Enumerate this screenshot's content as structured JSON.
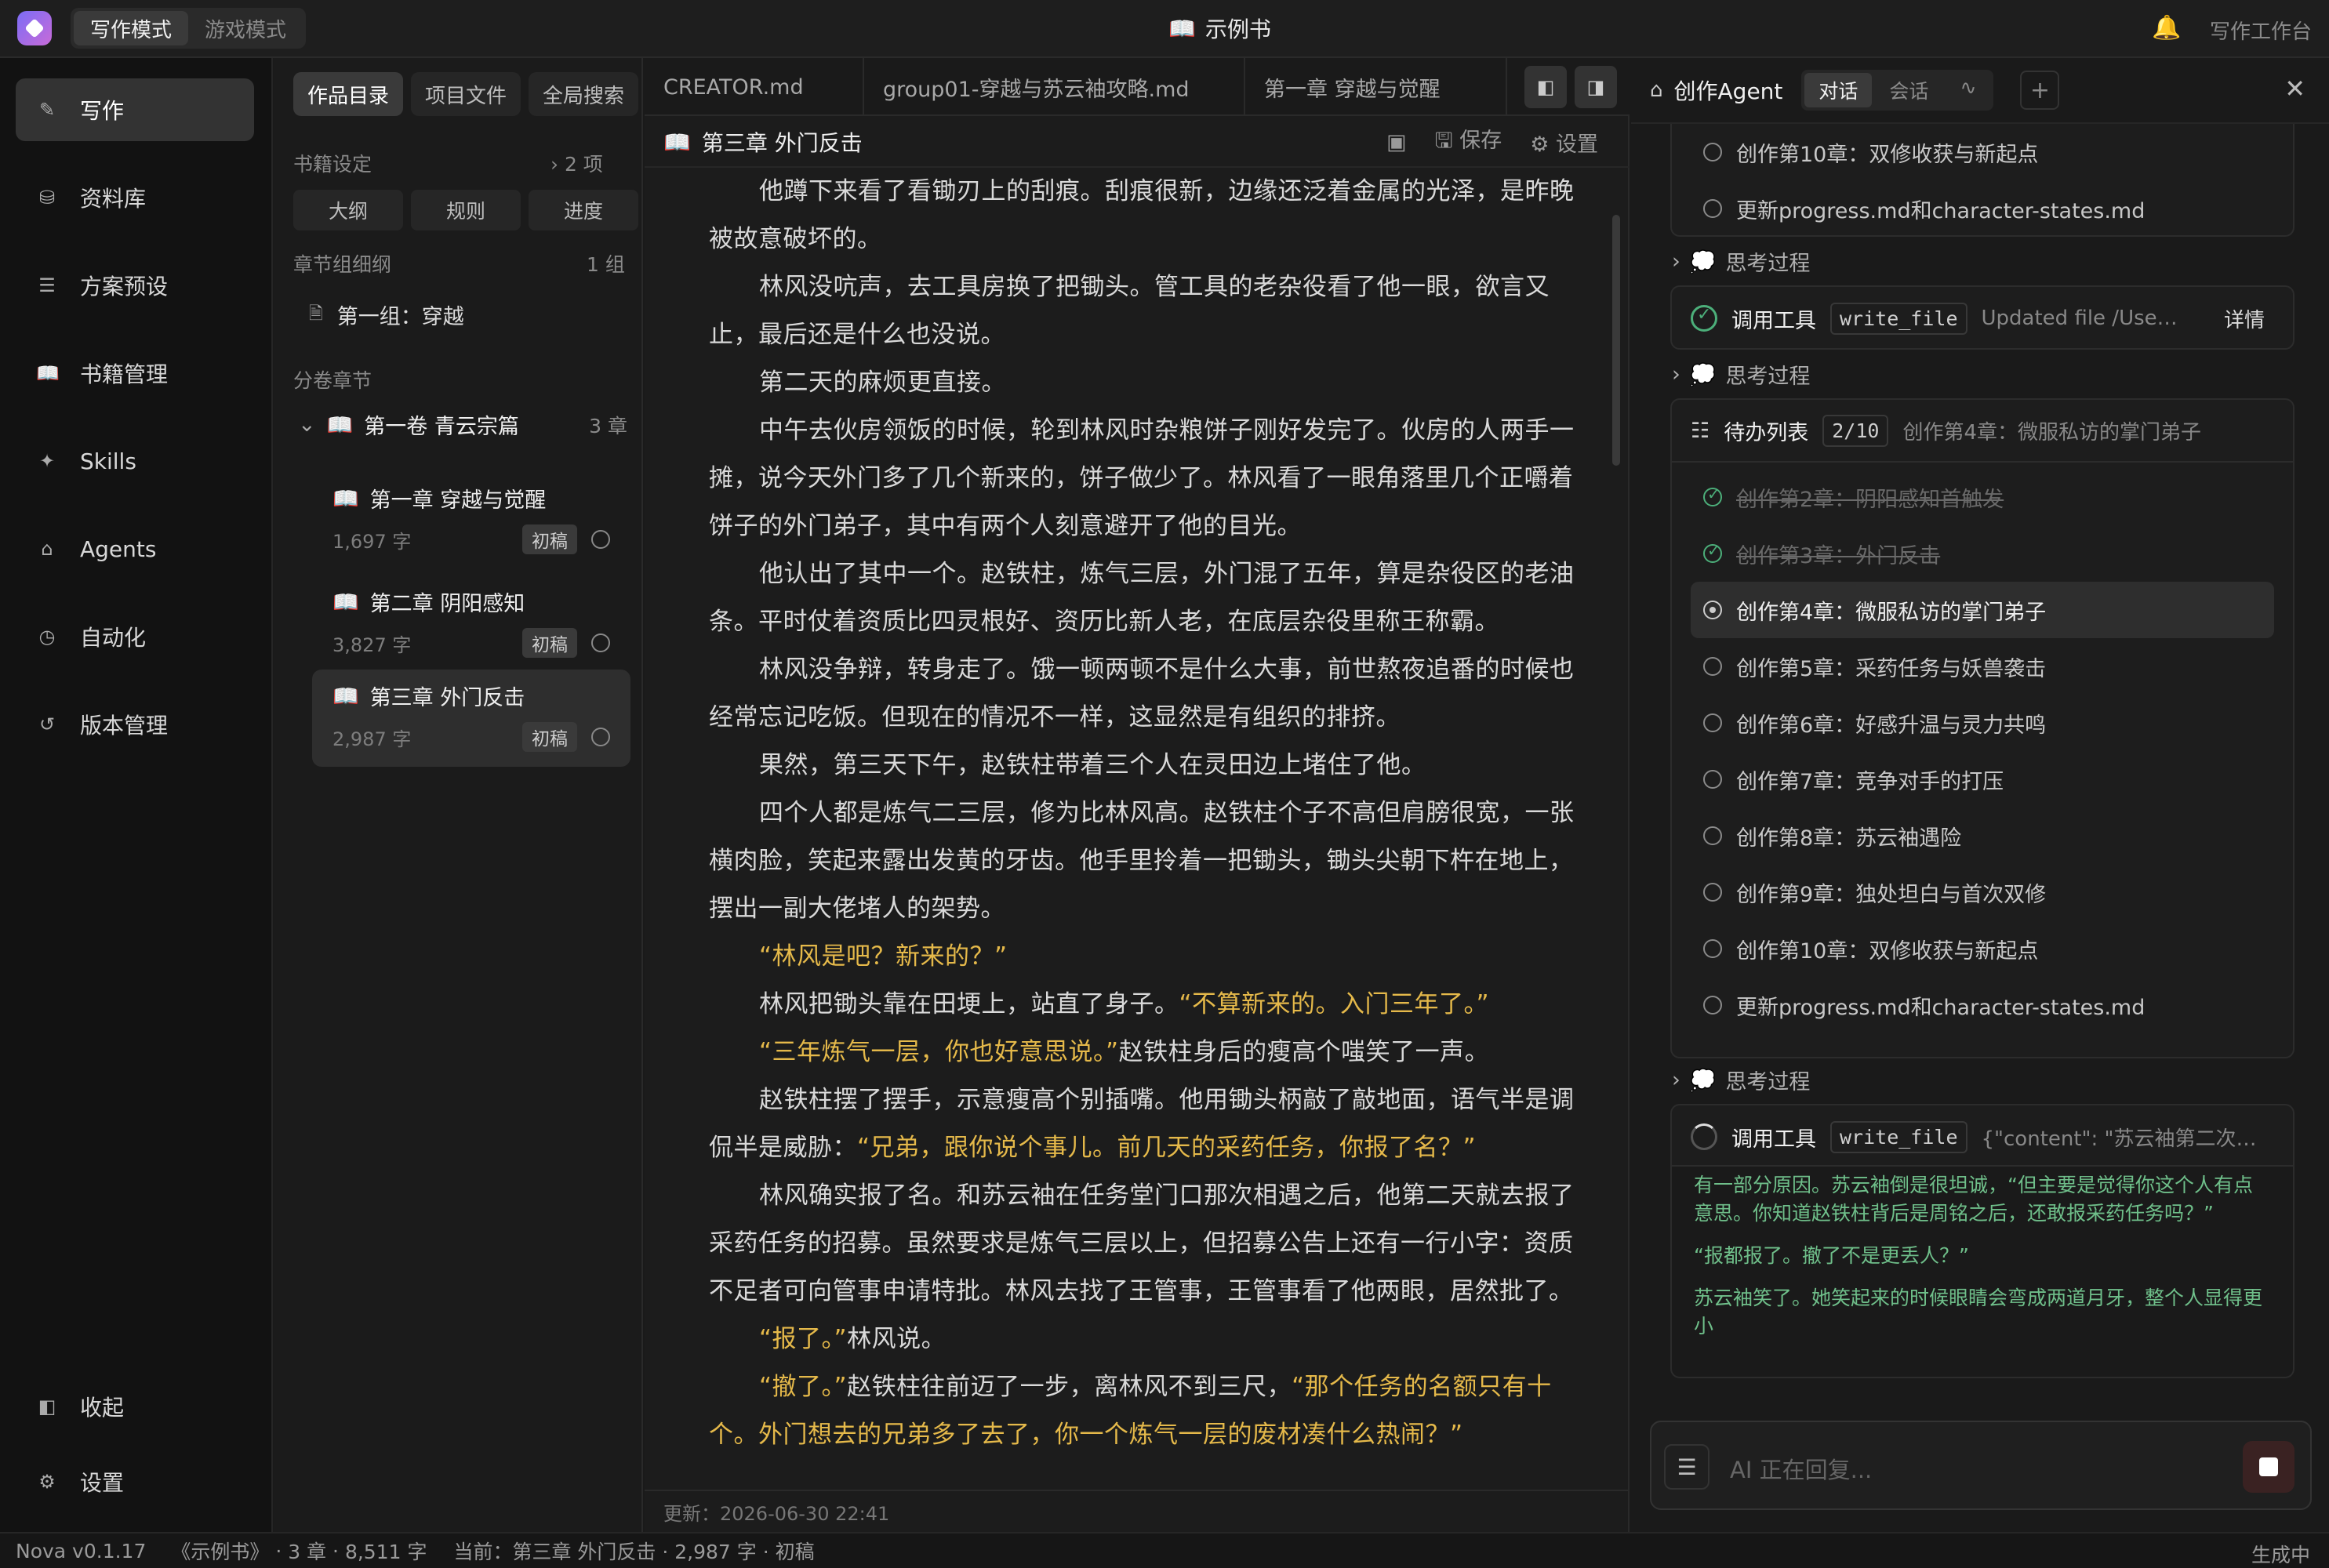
{
  "topbar": {
    "modes": [
      "写作模式",
      "游戏模式"
    ],
    "book_title": "示例书",
    "workbench": "写作工作台"
  },
  "leftnav": {
    "items": [
      {
        "label": "写作",
        "icon": "pen-icon"
      },
      {
        "label": "资料库",
        "icon": "database-icon"
      },
      {
        "label": "方案预设",
        "icon": "sliders-icon"
      },
      {
        "label": "书籍管理",
        "icon": "book-icon"
      },
      {
        "label": "Skills",
        "icon": "sparkle-icon"
      },
      {
        "label": "Agents",
        "icon": "robot-icon"
      },
      {
        "label": "自动化",
        "icon": "clock-icon"
      },
      {
        "label": "版本管理",
        "icon": "history-icon"
      }
    ],
    "collapse": "收起",
    "settings": "设置"
  },
  "tree": {
    "tabs": [
      "作品目录",
      "项目文件",
      "全局搜索"
    ],
    "book_settings": "书籍设定",
    "book_settings_count": "2 项",
    "pills": [
      "大纲",
      "规则",
      "进度"
    ],
    "group_outline": "章节组细纲",
    "group_count": "1 组",
    "group_item": "第一组：穿越",
    "chapters_label": "分卷章节",
    "volume": "第一卷 青云宗篇",
    "volume_count": "3 章",
    "chapters": [
      {
        "title": "第一章 穿越与觉醒",
        "words": "1,697 字",
        "status": "初稿"
      },
      {
        "title": "第二章 阴阳感知",
        "words": "3,827 字",
        "status": "初稿"
      },
      {
        "title": "第三章 外门反击",
        "words": "2,987 字",
        "status": "初稿"
      }
    ]
  },
  "editor": {
    "tabs": [
      "CREATOR.md",
      "group01-穿越与苏云袖攻略.md",
      "第一章 穿越与觉醒"
    ],
    "doc_title": "第三章 外门反击",
    "save": "保存",
    "settings": "设置",
    "updated": "更新：2026-06-30 22:41",
    "paragraphs": [
      {
        "parts": [
          {
            "t": "他蹲下来看了看锄刃上的刮痕。刮痕很新，边缘还泛着金属的光泽，是昨晚被故意破坏的。"
          }
        ]
      },
      {
        "parts": [
          {
            "t": "林风没吭声，去工具房换了把锄头。管工具的老杂役看了他一眼，欲言又止，最后还是什么也没说。"
          }
        ]
      },
      {
        "parts": [
          {
            "t": "第二天的麻烦更直接。"
          }
        ]
      },
      {
        "parts": [
          {
            "t": "中午去伙房领饭的时候，轮到林风时杂粮饼子刚好发完了。伙房的人两手一摊，说今天外门多了几个新来的，饼子做少了。林风看了一眼角落里几个正嚼着饼子的外门弟子，其中有两个人刻意避开了他的目光。"
          }
        ]
      },
      {
        "parts": [
          {
            "t": "他认出了其中一个。赵铁柱，炼气三层，外门混了五年，算是杂役区的老油条。平时仗着资质比四灵根好、资历比新人老，在底层杂役里称王称霸。"
          }
        ]
      },
      {
        "parts": [
          {
            "t": "林风没争辩，转身走了。饿一顿两顿不是什么大事，前世熬夜追番的时候也经常忘记吃饭。但现在的情况不一样，这显然是有组织的排挤。"
          }
        ]
      },
      {
        "parts": [
          {
            "t": "果然，第三天下午，赵铁柱带着三个人在灵田边上堵住了他。"
          }
        ]
      },
      {
        "parts": [
          {
            "t": "四个人都是炼气二三层，修为比林风高。赵铁柱个子不高但肩膀很宽，一张横肉脸，笑起来露出发黄的牙齿。他手里拎着一把锄头，锄头尖朝下杵在地上，摆出一副大佬堵人的架势。"
          }
        ]
      },
      {
        "parts": [
          {
            "t": "“林风是吧？新来的？”",
            "hl": true
          }
        ]
      },
      {
        "parts": [
          {
            "t": "林风把锄头靠在田埂上，站直了身子。"
          },
          {
            "t": "“不算新来的。入门三年了。”",
            "hl": true
          }
        ]
      },
      {
        "parts": [
          {
            "t": "“三年炼气一层，你也好意思说。”",
            "hl": true
          },
          {
            "t": "赵铁柱身后的瘦高个嗤笑了一声。"
          }
        ]
      },
      {
        "parts": [
          {
            "t": "赵铁柱摆了摆手，示意瘦高个别插嘴。他用锄头柄敲了敲地面，语气半是调侃半是威胁："
          },
          {
            "t": "“兄弟，跟你说个事儿。前几天的采药任务，你报了名？”",
            "hl": true
          }
        ]
      },
      {
        "parts": [
          {
            "t": "林风确实报了名。和苏云袖在任务堂门口那次相遇之后，他第二天就去报了采药任务的招募。虽然要求是炼气三层以上，但招募公告上还有一行小字：资质不足者可向管事申请特批。林风去找了王管事，王管事看了他两眼，居然批了。"
          }
        ]
      },
      {
        "parts": [
          {
            "t": "“报了。”",
            "hl": true
          },
          {
            "t": "林风说。"
          }
        ]
      },
      {
        "parts": [
          {
            "t": "“撤了。”",
            "hl": true
          },
          {
            "t": "赵铁柱往前迈了一步，离林风不到三尺，"
          },
          {
            "t": "“那个任务的名额只有十个。外门想去的兄弟多了去了，你一个炼气一层的废材凑什么热闹？”",
            "hl": true
          }
        ]
      }
    ]
  },
  "agent": {
    "title": "创作Agent",
    "tabs": [
      "对话",
      "会话"
    ],
    "top_todos": [
      "创作第10章：双修收获与新起点",
      "更新progress.md和character-states.md"
    ],
    "think": "思考过程",
    "tool_label": "调用工具",
    "tool1": {
      "name": "write_file",
      "desc": "Updated file /Use…",
      "detail": "详情"
    },
    "todo_title": "待办列表",
    "todo_progress": "2/10",
    "todo_current": "创作第4章：微服私访的掌门弟子",
    "todos": [
      {
        "label": "创作第2章：阴阳感知首触发",
        "state": "done"
      },
      {
        "label": "创作第3章：外门反击",
        "state": "done"
      },
      {
        "label": "创作第4章：微服私访的掌门弟子",
        "state": "current"
      },
      {
        "label": "创作第5章：采药任务与妖兽袭击",
        "state": "todo"
      },
      {
        "label": "创作第6章：好感升温与灵力共鸣",
        "state": "todo"
      },
      {
        "label": "创作第7章：竞争对手的打压",
        "state": "todo"
      },
      {
        "label": "创作第8章：苏云袖遇险",
        "state": "todo"
      },
      {
        "label": "创作第9章：独处坦白与首次双修",
        "state": "todo"
      },
      {
        "label": "创作第10章：双修收获与新起点",
        "state": "todo"
      },
      {
        "label": "更新progress.md和character-states.md",
        "state": "todo"
      }
    ],
    "tool2": {
      "name": "write_file",
      "desc": "{\"content\": \"苏云袖第二次…"
    },
    "stream": [
      "有一部分原因。苏云袖倒是很坦诚，“但主要是觉得你这个人有点意思。你知道赵铁柱背后是周铭之后，还敢报采药任务吗？”",
      "“报都报了。撤了不是更丢人？”",
      "苏云袖笑了。她笑起来的时候眼睛会弯成两道月牙，整个人显得更小"
    ],
    "input_placeholder": "AI 正在回复..."
  },
  "statusbar": {
    "version": "Nova v0.1.17",
    "book": "《示例书》",
    "chapters": "3 章",
    "words": "8,511 字",
    "current": "当前：第三章 外门反击 · 2,987 字 · 初稿",
    "state": "生成中"
  }
}
